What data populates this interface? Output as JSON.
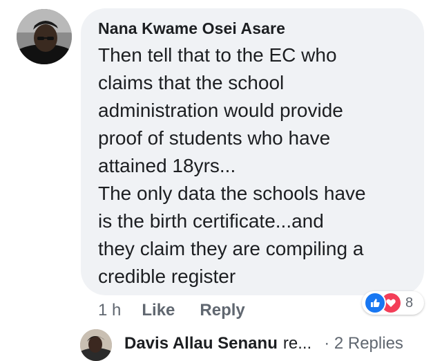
{
  "comment": {
    "author": "Nana Kwame Osei Asare",
    "text_lines": [
      "Then tell that to the EC who",
      "claims that the school",
      "administration would provide",
      "proof of students who have",
      "attained 18yrs...",
      "The only data the schools have",
      "is the birth certificate...and",
      "they claim they are compiling a",
      "credible register"
    ],
    "time": "1 h",
    "like_label": "Like",
    "reply_label": "Reply",
    "reactions": {
      "icons": [
        "like-icon",
        "love-icon"
      ],
      "count": "8",
      "like_color": "#1877f2",
      "love_color": "#f33e58"
    }
  },
  "replies_preview": {
    "author": "Davis Allau Senanu",
    "snippet": "re...",
    "count_label": "· 2 Replies"
  },
  "colors": {
    "bubble": "#f0f2f5",
    "text": "#1c1e21",
    "meta": "#606770"
  }
}
